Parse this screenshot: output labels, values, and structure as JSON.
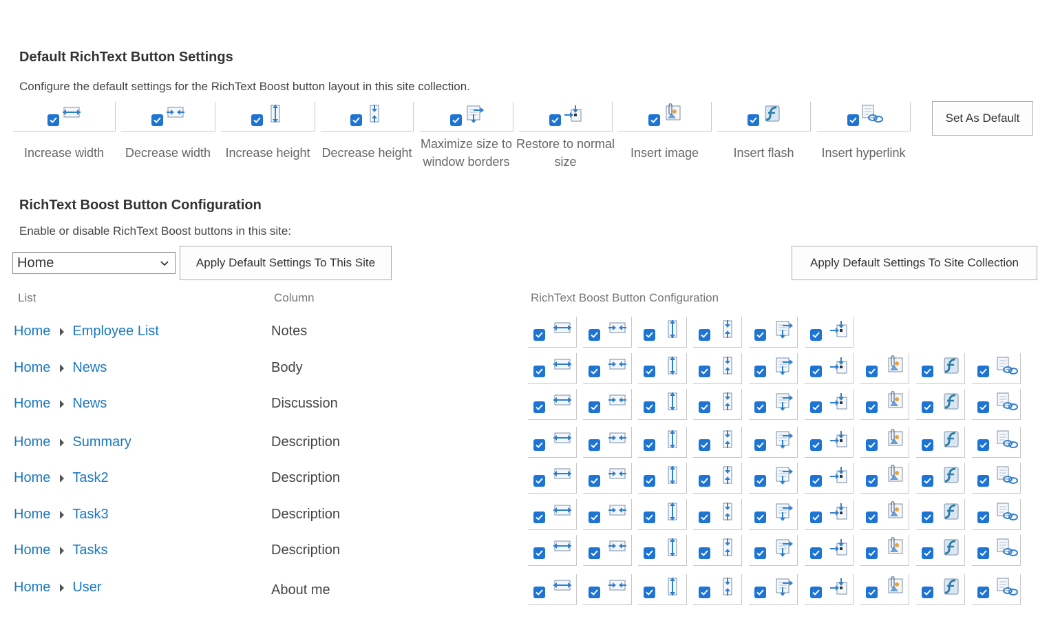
{
  "defaults_section": {
    "title": "Default RichText Button Settings",
    "description": "Configure the default settings for the RichText Boost button layout in this site collection.",
    "buttons": [
      {
        "label": "Increase width",
        "icon": "increase-width-icon",
        "checked": true
      },
      {
        "label": "Decrease width",
        "icon": "decrease-width-icon",
        "checked": true
      },
      {
        "label": "Increase height",
        "icon": "increase-height-icon",
        "checked": true
      },
      {
        "label": "Decrease height",
        "icon": "decrease-height-icon",
        "checked": true
      },
      {
        "label": "Maximize size to window borders",
        "icon": "maximize-icon",
        "checked": true
      },
      {
        "label": "Restore to normal size",
        "icon": "restore-icon",
        "checked": true
      },
      {
        "label": "Insert image",
        "icon": "insert-image-icon",
        "checked": true
      },
      {
        "label": "Insert flash",
        "icon": "insert-flash-icon",
        "checked": true
      },
      {
        "label": "Insert hyperlink",
        "icon": "insert-hyperlink-icon",
        "checked": true
      }
    ],
    "set_default_label": "Set As Default"
  },
  "config_section": {
    "title": "RichText Boost Button Configuration",
    "description": "Enable or disable RichText Boost buttons in this site:",
    "site_select_value": "Home",
    "apply_site_label": "Apply Default Settings To This Site",
    "apply_collection_label": "Apply Default Settings To Site Collection",
    "columns": {
      "list": "List",
      "column": "Column",
      "config": "RichText Boost Button Configuration"
    },
    "rows": [
      {
        "site": "Home",
        "list": "Employee List",
        "column": "Notes",
        "button_count": 6
      },
      {
        "site": "Home",
        "list": "News",
        "column": "Body",
        "button_count": 9
      },
      {
        "site": "Home",
        "list": "News",
        "column": "Discussion",
        "button_count": 9
      },
      {
        "site": "Home",
        "list": "Summary",
        "column": "Description",
        "button_count": 9
      },
      {
        "site": "Home",
        "list": "Task2",
        "column": "Description",
        "button_count": 9
      },
      {
        "site": "Home",
        "list": "Task3",
        "column": "Description",
        "button_count": 9
      },
      {
        "site": "Home",
        "list": "Tasks",
        "column": "Description",
        "button_count": 9
      },
      {
        "site": "Home",
        "list": "User",
        "column": "About me",
        "button_count": 9
      }
    ]
  },
  "colors": {
    "accent": "#1e74d2",
    "link": "#1a78c2"
  }
}
